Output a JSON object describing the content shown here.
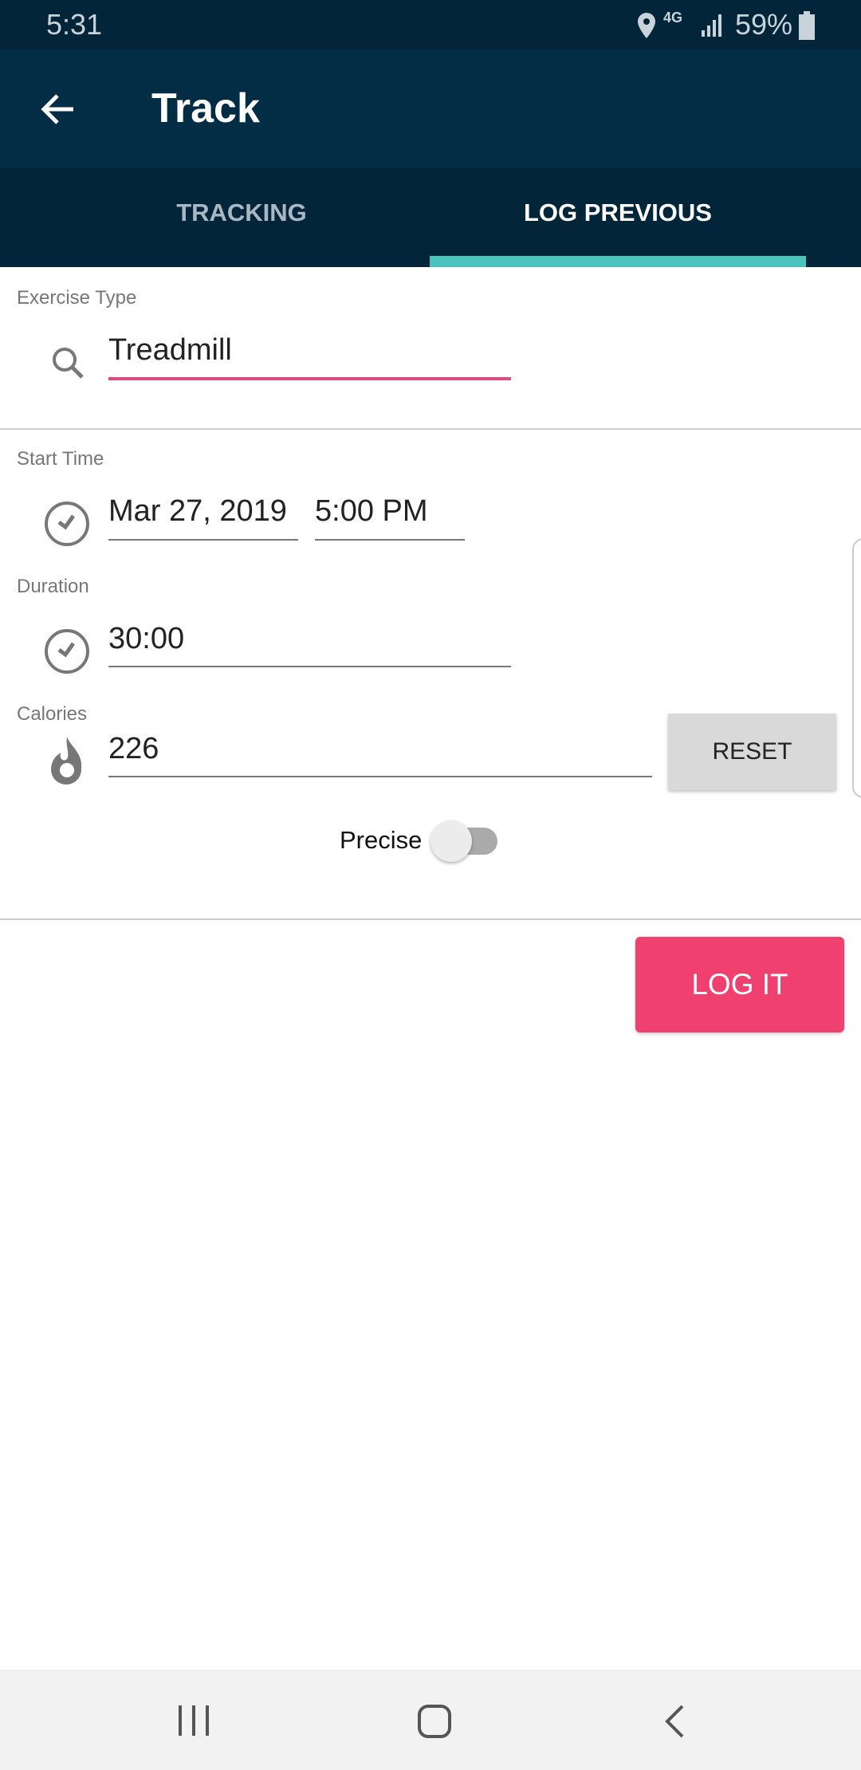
{
  "status_bar": {
    "time": "5:31",
    "network": "4G",
    "battery": "59%"
  },
  "app_bar": {
    "title": "Track",
    "back_icon": "arrow-left-icon"
  },
  "tabs": [
    {
      "label": "TRACKING",
      "active": false
    },
    {
      "label": "LOG PREVIOUS",
      "active": true
    }
  ],
  "colors": {
    "header": "#032c45",
    "tab_indicator": "#4cc2bf",
    "accent": "#f04070",
    "underline_active": "#e8457a"
  },
  "form": {
    "exercise_type": {
      "label": "Exercise Type",
      "value": "Treadmill",
      "icon": "search-icon"
    },
    "start_time": {
      "label": "Start Time",
      "date": "Mar 27, 2019",
      "time": "5:00 PM",
      "icon": "clock-icon"
    },
    "duration": {
      "label": "Duration",
      "value": "30:00",
      "icon": "clock-icon"
    },
    "calories": {
      "label": "Calories",
      "value": "226",
      "icon": "flame-icon",
      "reset_label": "RESET"
    },
    "precise": {
      "label": "Precise",
      "on": false
    }
  },
  "log_button": "LOG IT"
}
